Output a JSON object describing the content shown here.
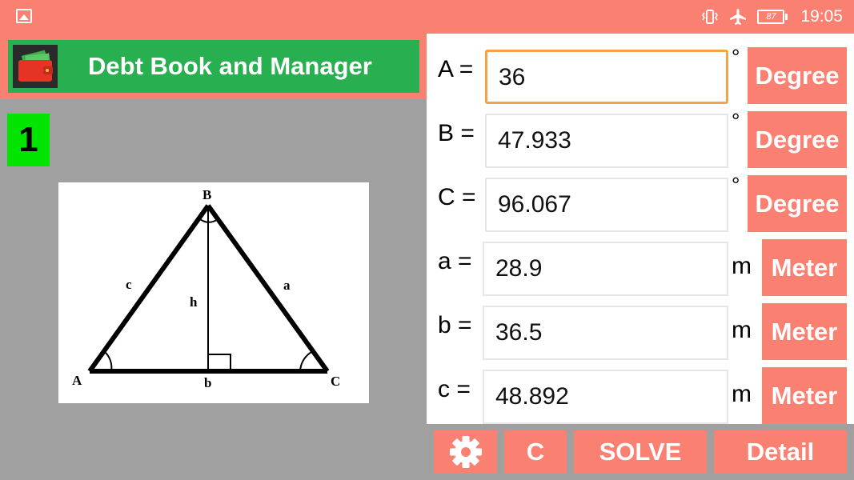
{
  "status_bar": {
    "battery_level": "87",
    "time": "19:05"
  },
  "ad_banner": {
    "title": "Debt Book and Manager"
  },
  "triangle_index": "1",
  "figure": {
    "labels": {
      "A": "A",
      "B": "B",
      "C": "C",
      "a": "a",
      "b": "b",
      "c": "c",
      "h": "h"
    }
  },
  "inputs": {
    "angles": [
      {
        "label": "A =",
        "value": "36",
        "unit_symbol": "°",
        "unit_button": "Degree"
      },
      {
        "label": "B =",
        "value": "47.933",
        "unit_symbol": "°",
        "unit_button": "Degree"
      },
      {
        "label": "C =",
        "value": "96.067",
        "unit_symbol": "°",
        "unit_button": "Degree"
      }
    ],
    "sides": [
      {
        "label": "a =",
        "value": "28.9",
        "unit_symbol": "m",
        "unit_button": "Meter"
      },
      {
        "label": "b =",
        "value": "36.5",
        "unit_symbol": "m",
        "unit_button": "Meter"
      },
      {
        "label": "c =",
        "value": "48.892",
        "unit_symbol": "m",
        "unit_button": "Meter"
      }
    ]
  },
  "actions": {
    "settings_icon": "gear-icon",
    "clear_label": "C",
    "solve_label": "SOLVE",
    "detail_label": "Detail"
  },
  "colors": {
    "accent": "#fa8072",
    "banner_green": "#28b050",
    "badge_green": "#00e400",
    "focus_border": "#f5a347",
    "background": "#a0a0a0"
  }
}
